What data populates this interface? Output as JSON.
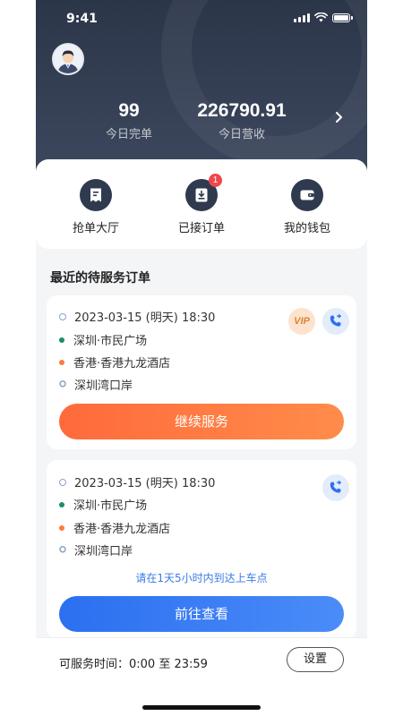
{
  "status_bar": {
    "time": "9:41"
  },
  "header": {
    "stats": [
      {
        "value": "99",
        "label": "今日完单"
      },
      {
        "value": "226790.91",
        "label": "今日营收"
      }
    ]
  },
  "menu": {
    "items": [
      {
        "label": "抢单大厅",
        "icon": "document-icon"
      },
      {
        "label": "已接订单",
        "icon": "inbox-icon",
        "badge": "1"
      },
      {
        "label": "我的钱包",
        "icon": "wallet-icon"
      }
    ]
  },
  "section_title": "最近的待服务订单",
  "orders": [
    {
      "time": "2023-03-15 (明天) 18:30",
      "from": "深圳·市民广场",
      "via": "香港·香港九龙酒店",
      "to": "深圳湾口岸",
      "vip_label": "VIP",
      "action": "继续服务"
    },
    {
      "time": "2023-03-15 (明天) 18:30",
      "from": "深圳·市民广场",
      "via": "香港·香港九龙酒店",
      "to": "深圳湾口岸",
      "hint": "请在1天5小时内到达上车点",
      "action": "前往查看"
    }
  ],
  "footer": {
    "service_time": "可服务时间：0:00 至 23:59",
    "settings_label": "设置"
  },
  "colors": {
    "header": "#2c3649",
    "accent_orange": "#ff6a3b",
    "accent_blue": "#2c6ff0",
    "badge": "#f0474b",
    "dot_green": "#1f8a6f",
    "dot_orange": "#ff7a3d"
  }
}
